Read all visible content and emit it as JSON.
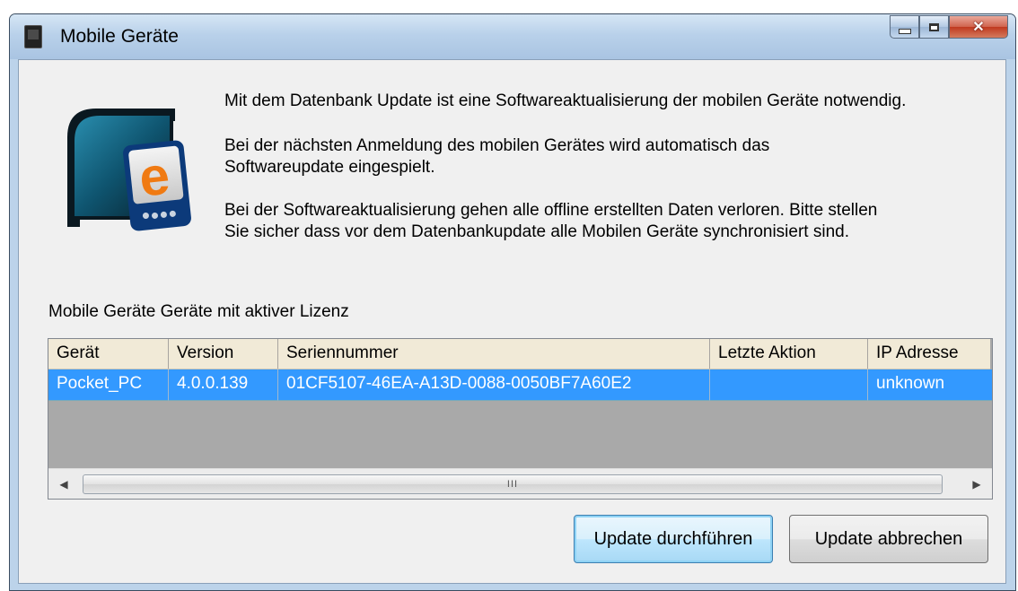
{
  "window": {
    "title": "Mobile Geräte"
  },
  "messages": {
    "line1": "Mit dem Datenbank Update ist eine Softwareaktualisierung der mobilen Geräte notwendig.",
    "line2a": "Bei der nächsten Anmeldung des mobilen Gerätes wird automatisch das",
    "line2b": "Softwareupdate eingespielt.",
    "line3a": "Bei der Softwareaktualisierung gehen alle offline erstellten Daten verloren. Bitte stellen",
    "line3b": "Sie sicher dass vor dem Datenbankupdate alle Mobilen Geräte synchronisiert sind."
  },
  "group_label": "Mobile Geräte Geräte mit aktiver Lizenz",
  "table": {
    "columns": [
      "Gerät",
      "Version",
      "Seriennummer",
      "Letzte Aktion",
      "IP Adresse"
    ],
    "rows": [
      [
        "Pocket_PC",
        "4.0.0.139",
        "01CF5107-46EA-A13D-0088-0050BF7A60E2",
        "",
        "unknown"
      ]
    ]
  },
  "scrollbar": {
    "grip": "III"
  },
  "buttons": {
    "update": "Update durchführen",
    "cancel": "Update abbrechen"
  },
  "logo": {
    "letter": "e"
  },
  "icons": {
    "app": "device-icon",
    "minimize": "minimize-icon",
    "maximize": "maximize-icon",
    "close": "close-icon"
  }
}
